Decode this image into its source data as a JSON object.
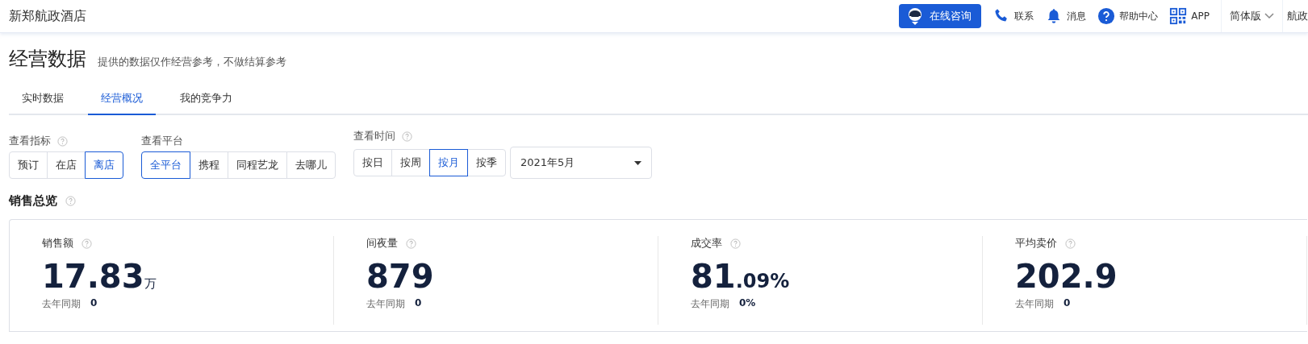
{
  "header": {
    "hotel_name": "新郑航政酒店",
    "consult_button": "在线咨询",
    "links": [
      {
        "kind": "phone",
        "label": "联系"
      },
      {
        "kind": "bell",
        "label": "消息"
      },
      {
        "kind": "help",
        "label": "帮助中心"
      },
      {
        "kind": "qr",
        "label": "APP"
      }
    ],
    "language": "简体版",
    "account": "航政"
  },
  "page": {
    "title": "经营数据",
    "subtitle": "提供的数据仅作经营参考，不做结算参考"
  },
  "tabs": [
    {
      "label": "实时数据",
      "selected": false
    },
    {
      "label": "经营概况",
      "selected": true
    },
    {
      "label": "我的竞争力",
      "selected": false
    }
  ],
  "filters": [
    {
      "label": "查看指标",
      "help": true,
      "options": [
        {
          "label": "预订",
          "selected": false
        },
        {
          "label": "在店",
          "selected": false
        },
        {
          "label": "离店",
          "selected": true
        }
      ]
    },
    {
      "label": "查看平台",
      "help": false,
      "options": [
        {
          "label": "全平台",
          "selected": true
        },
        {
          "label": "携程",
          "selected": false
        },
        {
          "label": "同程艺龙",
          "selected": false
        },
        {
          "label": "去哪儿",
          "selected": false
        }
      ]
    },
    {
      "label": "查看时间",
      "help": true,
      "options": [
        {
          "label": "按日",
          "selected": false
        },
        {
          "label": "按周",
          "selected": false
        },
        {
          "label": "按月",
          "selected": true
        },
        {
          "label": "按季",
          "selected": false
        }
      ],
      "date": "2021年5月"
    }
  ],
  "summary": {
    "title": "销售总览",
    "stats": [
      {
        "label": "销售额",
        "value": "17.83",
        "suffix": "万",
        "compare_label": "去年同期",
        "compare_value": "0"
      },
      {
        "label": "间夜量",
        "value": "879",
        "compare_label": "去年同期",
        "compare_value": "0"
      },
      {
        "label": "成交率",
        "value": "81",
        "suffix": ".09%",
        "compare_label": "去年同期",
        "compare_value": "0%"
      },
      {
        "label": "平均卖价",
        "value": "202.9",
        "compare_label": "去年同期",
        "compare_value": "0"
      }
    ]
  }
}
